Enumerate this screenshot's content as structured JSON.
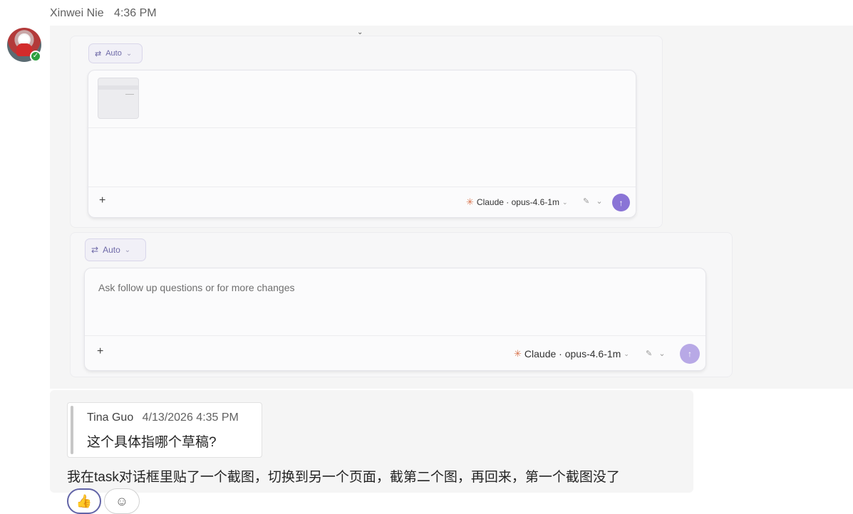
{
  "header": {
    "sender": "Xinwei Nie",
    "time": "4:36 PM"
  },
  "avatar": {
    "name": "avatar",
    "presence": "available",
    "presence_color": "#2d9f3f"
  },
  "screenshot": {
    "top_panel": {
      "auto_label": "Auto",
      "model_label": "Claude · opus-4.6-1m",
      "send_icon": "arrow-up-icon"
    },
    "bottom_panel": {
      "auto_label": "Auto",
      "placeholder": "Ask follow up questions or for more changes",
      "model_label": "Claude · opus-4.6-1m",
      "send_icon": "arrow-up-icon"
    },
    "accent": "#8a74d6"
  },
  "reply": {
    "quote_author": "Tina Guo",
    "quote_time": "4/13/2026 4:35 PM",
    "quote_text": "这个具体指哪个草稿?",
    "body": "我在task对话框里贴了一个截图，切换到另一个页面，截第二个图，再回来，第一个截图没了"
  },
  "reactions": {
    "like": "👍",
    "add_icon": "add-reaction-icon"
  }
}
